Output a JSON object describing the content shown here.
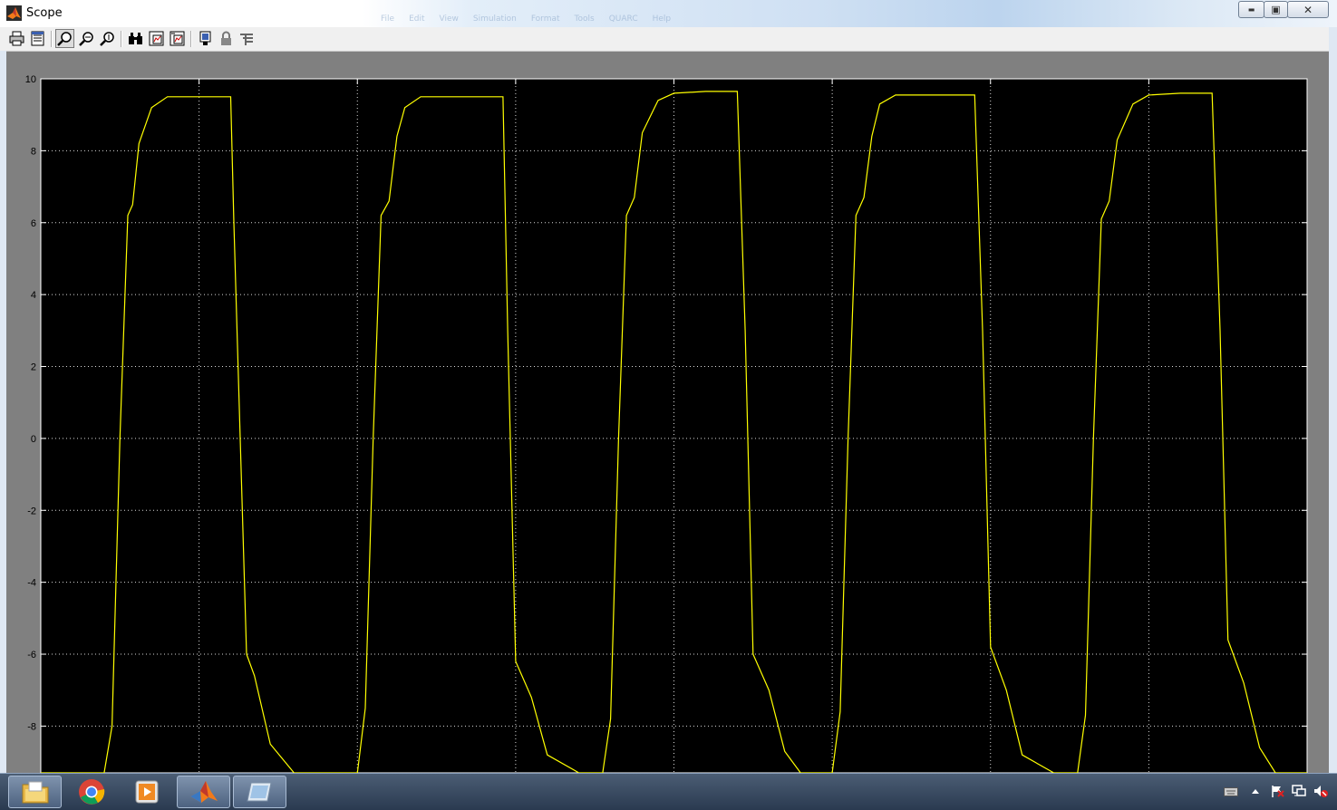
{
  "window": {
    "title": "Scope"
  },
  "background_menu": [
    "File",
    "Edit",
    "View",
    "Simulation",
    "Format",
    "Tools",
    "QUARC",
    "Help"
  ],
  "window_controls": {
    "minimize": "▬",
    "maximize": "▣",
    "close": "✕"
  },
  "toolbar": {
    "items": [
      {
        "name": "print-icon",
        "glyph": "print"
      },
      {
        "name": "parameters-icon",
        "glyph": "params"
      },
      {
        "name": "zoom-icon",
        "glyph": "zoom",
        "pressed": true
      },
      {
        "name": "zoom-x-icon",
        "glyph": "zoomx"
      },
      {
        "name": "zoom-y-icon",
        "glyph": "zoomy"
      },
      {
        "name": "autoscale-icon",
        "glyph": "binoculars"
      },
      {
        "name": "save-axes-settings-icon",
        "glyph": "saveaxes"
      },
      {
        "name": "restore-axes-settings-icon",
        "glyph": "restoreaxes"
      },
      {
        "name": "floating-scope-icon",
        "glyph": "float"
      },
      {
        "name": "lock-axes-icon",
        "glyph": "lock"
      },
      {
        "name": "signal-selection-icon",
        "glyph": "signal"
      }
    ],
    "dock_glyph": "↘"
  },
  "colors": {
    "plot_bg": "#000000",
    "trace": "#ffff00",
    "grid": "#ffffff",
    "figure_bg": "#808080",
    "tick_text": "#000000"
  },
  "chart_data": {
    "type": "line",
    "title": "",
    "xlabel": "",
    "ylabel": "",
    "ylim": [
      -9.3,
      10
    ],
    "xlim": [
      0,
      8
    ],
    "x_ticks_shown": false,
    "y_ticks": [
      10,
      8,
      6,
      4,
      2,
      0,
      -2,
      -4,
      -6,
      -8
    ],
    "y_tick_labels": [
      "10",
      "8",
      "6",
      "4",
      "2",
      "0",
      "-2",
      "-4",
      "-6",
      "-8"
    ],
    "grid": true,
    "series": [
      {
        "name": "",
        "color": "#ffff00",
        "x": [
          0.0,
          0.4,
          0.45,
          0.5,
          0.55,
          0.58,
          0.62,
          0.7,
          0.8,
          1.0,
          1.2,
          1.22,
          1.3,
          1.35,
          1.45,
          1.6,
          1.8,
          2.0,
          2.05,
          2.1,
          2.15,
          2.2,
          2.25,
          2.3,
          2.4,
          2.6,
          2.8,
          2.92,
          2.95,
          3.0,
          3.1,
          3.2,
          3.4,
          3.55,
          3.6,
          3.65,
          3.7,
          3.75,
          3.8,
          3.9,
          4.0,
          4.2,
          4.4,
          4.45,
          4.5,
          4.6,
          4.7,
          4.8,
          5.0,
          5.05,
          5.1,
          5.15,
          5.2,
          5.25,
          5.3,
          5.4,
          5.6,
          5.9,
          5.95,
          6.0,
          6.1,
          6.2,
          6.4,
          6.55,
          6.6,
          6.65,
          6.7,
          6.75,
          6.8,
          6.9,
          7.0,
          7.2,
          7.4,
          7.45,
          7.5,
          7.6,
          7.7,
          7.8,
          8.0
        ],
        "y": [
          -9.3,
          -9.3,
          -8.0,
          0.0,
          6.2,
          6.5,
          8.2,
          9.2,
          9.5,
          9.5,
          9.5,
          6.0,
          -6.0,
          -6.6,
          -8.5,
          -9.3,
          -9.3,
          -9.3,
          -7.5,
          0.0,
          6.2,
          6.6,
          8.4,
          9.2,
          9.5,
          9.5,
          9.5,
          9.5,
          3.0,
          -6.2,
          -7.2,
          -8.8,
          -9.3,
          -9.3,
          -7.8,
          0.0,
          6.2,
          6.7,
          8.5,
          9.4,
          9.6,
          9.65,
          9.65,
          3.0,
          -6.0,
          -7.0,
          -8.7,
          -9.3,
          -9.3,
          -7.6,
          0.0,
          6.2,
          6.7,
          8.4,
          9.3,
          9.55,
          9.55,
          9.55,
          3.0,
          -5.8,
          -7.0,
          -8.8,
          -9.3,
          -9.3,
          -7.7,
          0.0,
          6.1,
          6.6,
          8.3,
          9.3,
          9.55,
          9.6,
          9.6,
          3.0,
          -5.6,
          -6.8,
          -8.6,
          -9.3,
          -9.3
        ]
      }
    ]
  },
  "taskbar": {
    "apps": [
      {
        "name": "file-explorer-icon",
        "active": true
      },
      {
        "name": "chrome-icon",
        "active": false
      },
      {
        "name": "media-player-icon",
        "active": false
      },
      {
        "name": "matlab-icon",
        "active": true
      },
      {
        "name": "matlab-figure-icon",
        "active": true
      }
    ],
    "tray": [
      "keyboard-icon",
      "show-hidden-icons-icon",
      "action-center-icon",
      "network-icon",
      "volume-muted-icon"
    ]
  }
}
